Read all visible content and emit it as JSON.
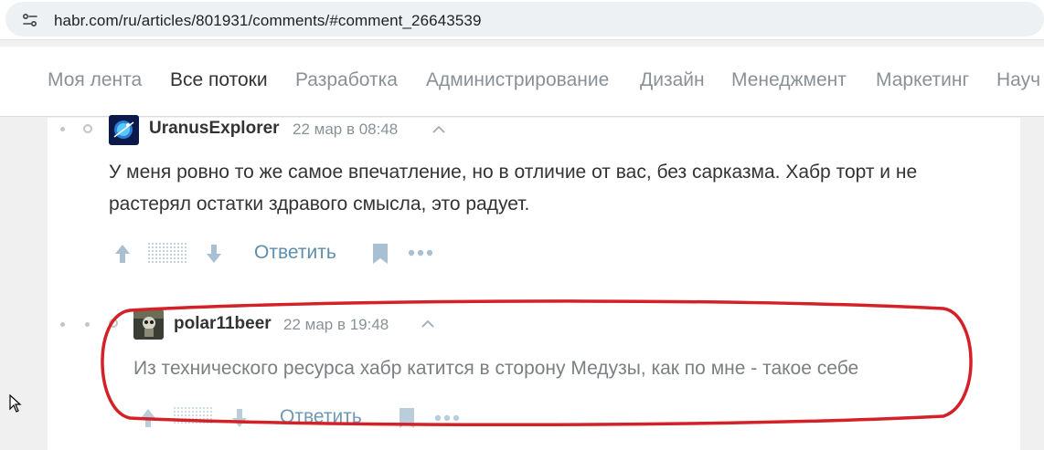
{
  "browser": {
    "url": "habr.com/ru/articles/801931/comments/#comment_26643539"
  },
  "nav": {
    "items": [
      "Моя лента",
      "Все потоки",
      "Разработка",
      "Администрирование",
      "Дизайн",
      "Менеджмент",
      "Маркетинг",
      "Науч"
    ],
    "active_index": 1
  },
  "comments": [
    {
      "username": "UranusExplorer",
      "timestamp": "22 мар в 08:48",
      "text_line1": "У меня ровно то же самое впечатление, но в отличие от вас, без сарказма. Хабр торт и не",
      "text_line2": "растерял остатки здравого смысла, это радует.",
      "reply_label": "Ответить"
    },
    {
      "username": "polar11beer",
      "timestamp": "22 мар в 19:48",
      "text_line1": "Из технического ресурса хабр катится в сторону Медузы, как по мне - такое себе",
      "reply_label": "Ответить"
    }
  ],
  "colors": {
    "highlight": "#d42027",
    "link": "#5e8fad",
    "icon": "#a9c0d2"
  }
}
